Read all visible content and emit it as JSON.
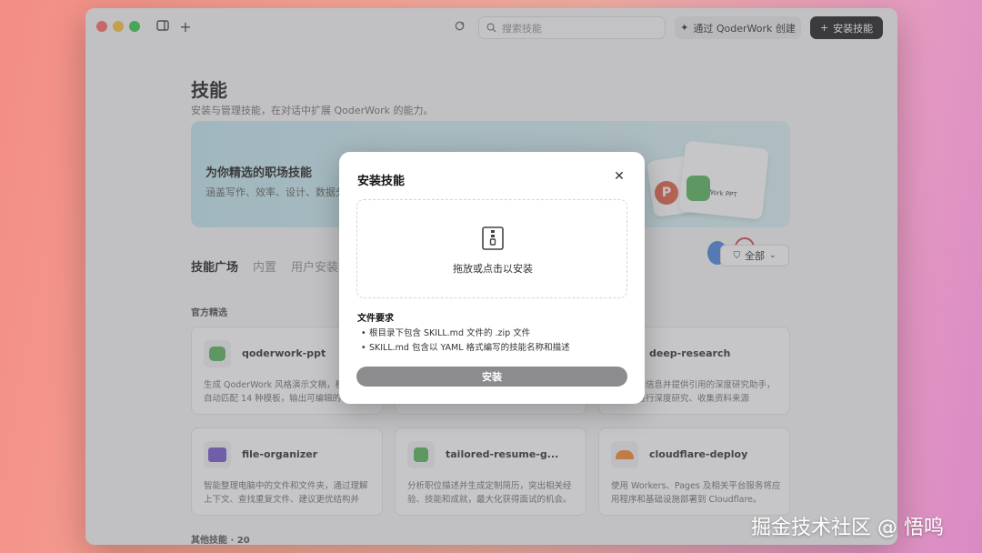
{
  "titlebar": {
    "search_placeholder": "搜索技能",
    "create_label": "通过 QoderWork 创建",
    "install_label": "安装技能"
  },
  "page": {
    "title": "技能",
    "subtitle": "安装与管理技能，在对话中扩展 QoderWork 的能力。"
  },
  "banner": {
    "title": "为你精选的职场技能",
    "subtitle": "涵盖写作、效率、设计、数据分",
    "deco_card_label": "QoderWork PPT"
  },
  "tabs": [
    {
      "label": "技能广场",
      "active": true
    },
    {
      "label": "内置",
      "active": false
    },
    {
      "label": "用户安装",
      "active": false
    }
  ],
  "filter": {
    "label": "全部"
  },
  "sections": {
    "official": "官方精选",
    "others": "其他技能 · 20"
  },
  "skills": [
    {
      "name": "qoderwork-ppt",
      "desc": "生成 QoderWork 风格演示文稿，根据内容自动匹配 14 种模板，输出可编辑的"
    },
    {
      "name": "deep-research",
      "desc": "汇总多源信息并提供引用的深度研究助手，适用于进行深度研究、收集资料来源"
    },
    {
      "name": "file-organizer",
      "desc": "智能整理电脑中的文件和文件夹，通过理解上下文、查找重复文件、建议更优结构并"
    },
    {
      "name": "tailored-resume-g...",
      "desc": "分析职位描述并生成定制简历，突出相关经验、技能和成就，最大化获得面试的机会。"
    },
    {
      "name": "cloudflare-deploy",
      "desc": "使用 Workers、Pages 及相关平台服务将应用程序和基础设施部署到 Cloudflare。"
    }
  ],
  "modal": {
    "title": "安装技能",
    "drop_text": "拖放或点击以安装",
    "requirements_title": "文件要求",
    "requirements": [
      "根目录下包含 SKILL.md 文件的 .zip 文件",
      "SKILL.md 包含以 YAML 格式编写的技能名称和描述"
    ],
    "install_label": "安装"
  },
  "watermark": "掘金技术社区 @ 悟鸣",
  "colors": {
    "accent_dark": "#111111",
    "install_disabled": "#8c8c8e",
    "banner": "#bfe6ee"
  }
}
